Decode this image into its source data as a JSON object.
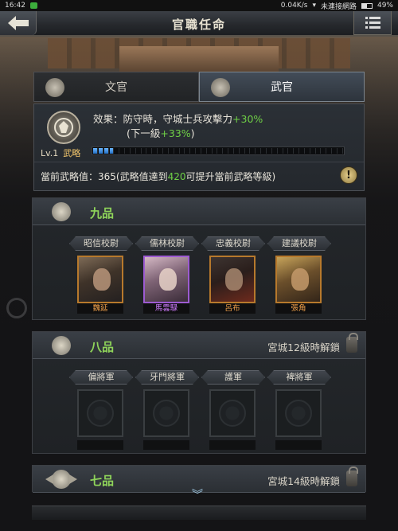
{
  "status": {
    "time": "16:42",
    "speed": "0.04K/s",
    "network": "未連接網路",
    "battery": "49%"
  },
  "header": {
    "title": "官職任命"
  },
  "tabs": [
    {
      "label": "文官",
      "active": false
    },
    {
      "label": "武官",
      "active": true
    }
  ],
  "effect": {
    "line1_prefix": "效果：防守時，守城士兵攻擊力",
    "line1_bonus": "+30%",
    "line2_prefix": "(下一級",
    "line2_bonus": "+33%",
    "line2_suffix": ")",
    "level": "Lv.1",
    "stat_label": "武略",
    "progress_fraction": 0.087,
    "current_prefix": "當前武略值：365(武略值達到",
    "current_target": "420",
    "current_suffix": "可提升當前武略等級)",
    "info_glyph": "!"
  },
  "ranks": [
    {
      "name": "九品",
      "unlock": "",
      "slots": [
        {
          "title": "昭信校尉",
          "general": "魏延",
          "quality": "orange"
        },
        {
          "title": "儒林校尉",
          "general": "馬雲騄",
          "quality": "purple"
        },
        {
          "title": "忠義校尉",
          "general": "呂布",
          "quality": "orange"
        },
        {
          "title": "建議校尉",
          "general": "張角",
          "quality": "orange"
        }
      ]
    },
    {
      "name": "八品",
      "unlock": "宮城12級時解鎖",
      "slots": [
        {
          "title": "偏將軍"
        },
        {
          "title": "牙門將軍"
        },
        {
          "title": "護軍"
        },
        {
          "title": "裨將軍"
        }
      ]
    },
    {
      "name": "七品",
      "unlock": "宮城14級時解鎖",
      "slots": []
    }
  ],
  "colors": {
    "green_highlight": "#6fd046",
    "rank_name": "#8fd45a",
    "orange_quality": "#f3a24b",
    "purple_quality": "#d07cff"
  },
  "icons": {
    "back": "back-arrow-icon",
    "menu": "list-menu-icon",
    "scroll": "chevron-double-down-icon"
  }
}
